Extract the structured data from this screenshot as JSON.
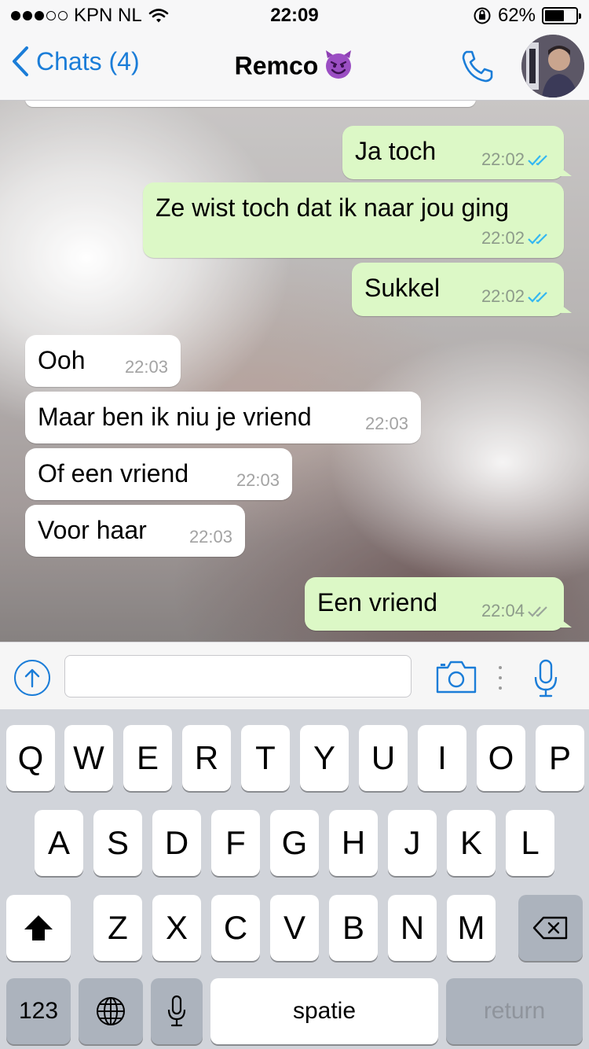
{
  "status_bar": {
    "carrier": "KPN NL",
    "time": "22:09",
    "battery": "62%",
    "battery_level": 0.62,
    "signal_bars": 3,
    "signal_total": 5
  },
  "nav": {
    "back_label": "Chats (4)",
    "title": "Remco",
    "title_emoji": "smiling-imp",
    "call_icon": "phone-icon",
    "avatar_icon": "contact-avatar"
  },
  "messages": [
    {
      "direction": "out",
      "text": "Ja toch",
      "time": "22:02",
      "status": "read"
    },
    {
      "direction": "out",
      "text": "Ze wist toch dat ik naar jou ging",
      "time": "22:02",
      "status": "read"
    },
    {
      "direction": "out",
      "text": "Sukkel",
      "time": "22:02",
      "status": "read"
    },
    {
      "direction": "in",
      "text": "Ooh",
      "time": "22:03"
    },
    {
      "direction": "in",
      "text": "Maar ben ik niu je vriend",
      "time": "22:03"
    },
    {
      "direction": "in",
      "text": "Of een vriend",
      "time": "22:03"
    },
    {
      "direction": "in",
      "text": "Voor haar",
      "time": "22:03"
    },
    {
      "direction": "out",
      "text": "Een vriend",
      "time": "22:04",
      "status": "delivered"
    }
  ],
  "input_bar": {
    "message_value": "",
    "icons": [
      "upload-icon",
      "camera-icon",
      "microphone-icon"
    ]
  },
  "keyboard": {
    "row1": [
      "Q",
      "W",
      "E",
      "R",
      "T",
      "Y",
      "U",
      "I",
      "O",
      "P"
    ],
    "row2": [
      "A",
      "S",
      "D",
      "F",
      "G",
      "H",
      "J",
      "K",
      "L"
    ],
    "row3": [
      "Z",
      "X",
      "C",
      "V",
      "B",
      "N",
      "M"
    ],
    "numbers_label": "123",
    "space_label": "spatie",
    "return_label": "return"
  },
  "colors": {
    "accent": "#1b7dd8",
    "outgoing_bubble": "#dcf8c6",
    "incoming_bubble": "#ffffff",
    "read_ticks": "#34b7f1",
    "delivered_ticks": "#9aa59a"
  }
}
